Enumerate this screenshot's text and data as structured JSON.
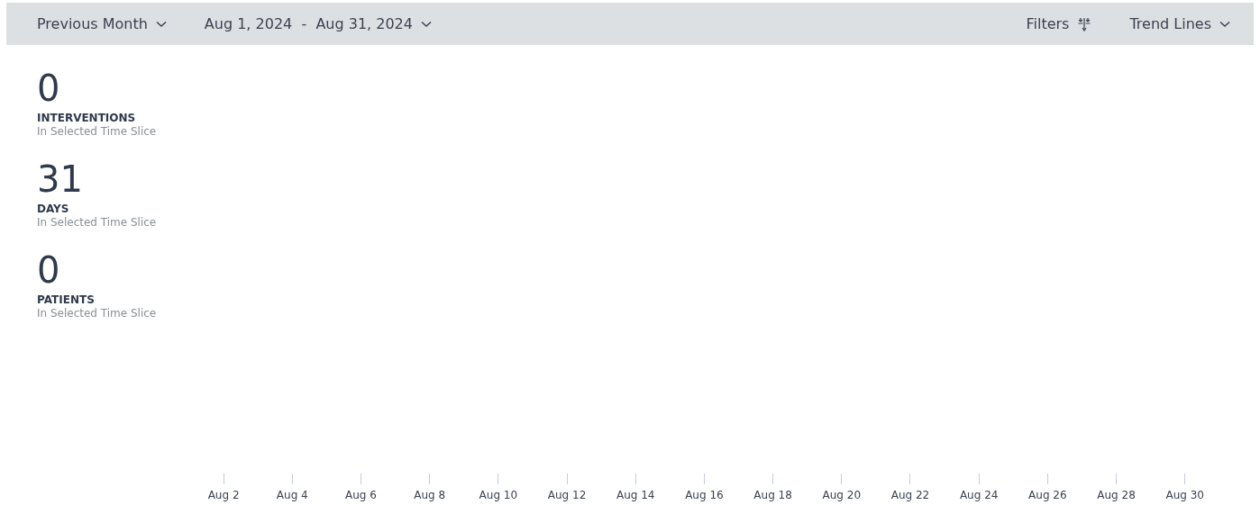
{
  "toolbar": {
    "period": "Previous Month",
    "date_range": "Aug 1, 2024  -  Aug 31, 2024",
    "filters": "Filters",
    "trend_lines": "Trend Lines"
  },
  "stats": [
    {
      "value": "0",
      "label": "INTERVENTIONS",
      "caption": "In Selected Time Slice"
    },
    {
      "value": "31",
      "label": "DAYS",
      "caption": "In Selected Time Slice"
    },
    {
      "value": "0",
      "label": "PATIENTS",
      "caption": "In Selected Time Slice"
    }
  ],
  "axis": {
    "ticks": [
      "Aug 2",
      "Aug 4",
      "Aug 6",
      "Aug 8",
      "Aug 10",
      "Aug 12",
      "Aug 14",
      "Aug 16",
      "Aug 18",
      "Aug 20",
      "Aug 22",
      "Aug 24",
      "Aug 26",
      "Aug 28",
      "Aug 30"
    ]
  }
}
